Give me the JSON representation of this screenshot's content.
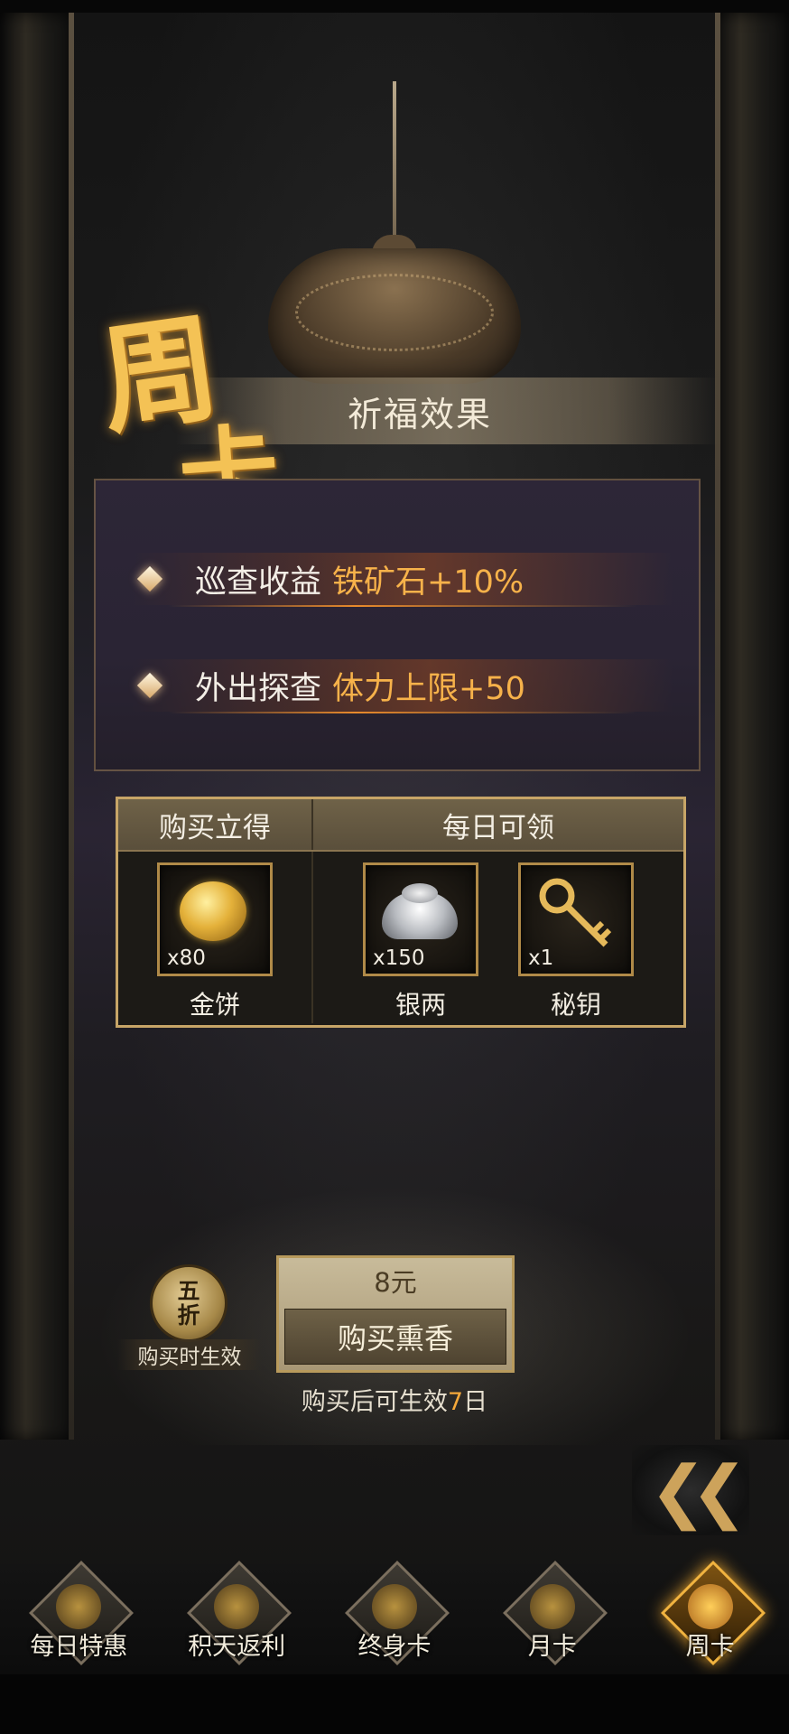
{
  "panel": {
    "title": "祈福效果",
    "logo_char_1": "周",
    "logo_char_2": "卡"
  },
  "effects": [
    {
      "label": "巡查收益",
      "value": "铁矿石+10%"
    },
    {
      "label": "外出探查",
      "value": "体力上限+50"
    }
  ],
  "rewards": {
    "instant_header": "购买立得",
    "daily_header": "每日可领",
    "items": [
      {
        "name": "金饼",
        "count": "x80",
        "icon": "gold-cake-icon"
      },
      {
        "name": "银两",
        "count": "x150",
        "icon": "silver-ingot-icon"
      },
      {
        "name": "秘钥",
        "count": "x1",
        "icon": "key-icon"
      }
    ]
  },
  "purchase": {
    "discount_text": "五折",
    "discount_caption": "购买时生效",
    "price": "8元",
    "button_label": "购买熏香",
    "duration_prefix": "购买后可生效",
    "duration_days": "7",
    "duration_suffix": "日"
  },
  "nav": {
    "items": [
      {
        "label": "每日特惠",
        "icon": "incense-burner-icon",
        "active": false
      },
      {
        "label": "积天返利",
        "icon": "scroll-bundle-icon",
        "active": false
      },
      {
        "label": "终身卡",
        "icon": "dragon-icon",
        "active": false
      },
      {
        "label": "月卡",
        "icon": "lotus-icon",
        "active": false
      },
      {
        "label": "周卡",
        "icon": "golden-burner-icon",
        "active": true
      }
    ]
  },
  "colors": {
    "accent_gold": "#f7b24a",
    "active_tab": "#f1b33f",
    "frame_gold": "#c7a567"
  }
}
